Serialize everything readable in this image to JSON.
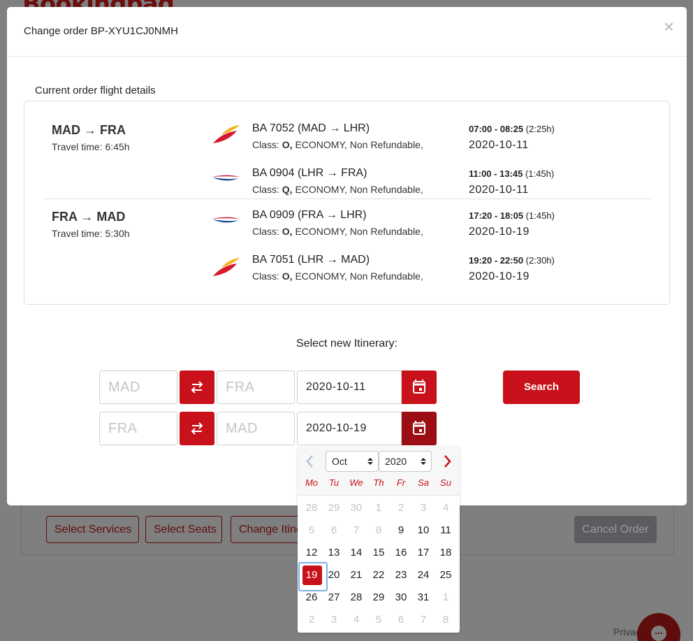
{
  "background": {
    "logo": "Bookingpad",
    "buttons": [
      "Select Services",
      "Select Seats",
      "Change Itine"
    ],
    "cancel_order": "Cancel Order",
    "privacy": "Privac",
    "chat_dots": "..."
  },
  "modal": {
    "title": "Change order BP-XYU1CJ0NMH",
    "close": "×",
    "section_title": "Current order flight details",
    "journeys": [
      {
        "route": "MAD → FRA",
        "travel_time": "Travel time: 6:45h",
        "flights": [
          {
            "airline_icon": "iberia-logo",
            "number": "BA 7052 (MAD → LHR)",
            "class_prefix": "Class: ",
            "class_code": "O,",
            "class_rest": " ECONOMY, Non Refundable,",
            "time_range": "07:00 - 08:25",
            "duration": " (2:25h)",
            "date": "2020-10-11"
          },
          {
            "airline_icon": "british-airways-logo",
            "number": "BA 0904 (LHR → FRA)",
            "class_prefix": "Class: ",
            "class_code": "Q,",
            "class_rest": " ECONOMY, Non Refundable,",
            "time_range": "11:00 - 13:45",
            "duration": " (1:45h)",
            "date": "2020-10-11"
          }
        ]
      },
      {
        "route": "FRA → MAD",
        "travel_time": "Travel time: 5:30h",
        "flights": [
          {
            "airline_icon": "british-airways-logo",
            "number": "BA 0909 (FRA → LHR)",
            "class_prefix": "Class: ",
            "class_code": "O,",
            "class_rest": " ECONOMY, Non Refundable,",
            "time_range": "17:20 - 18:05",
            "duration": " (1:45h)",
            "date": "2020-10-19"
          },
          {
            "airline_icon": "iberia-logo",
            "number": "BA 7051 (LHR → MAD)",
            "class_prefix": "Class: ",
            "class_code": "O,",
            "class_rest": " ECONOMY, Non Refundable,",
            "time_range": "19:20 - 22:50",
            "duration": " (2:30h)",
            "date": "2020-10-19"
          }
        ]
      }
    ],
    "itinerary_title": "Select new Itinerary:",
    "legs": [
      {
        "from_placeholder": "MAD",
        "to_placeholder": "FRA",
        "date": "2020-10-11"
      },
      {
        "from_placeholder": "FRA",
        "to_placeholder": "MAD",
        "date": "2020-10-19"
      }
    ],
    "search_label": "Search"
  },
  "datepicker": {
    "month": "Oct",
    "year": "2020",
    "weekdays": [
      "Mo",
      "Tu",
      "We",
      "Th",
      "Fr",
      "Sa",
      "Su"
    ],
    "days": [
      [
        "28",
        "29",
        "30",
        "1",
        "2",
        "3",
        "4"
      ],
      [
        "5",
        "6",
        "7",
        "8",
        "9",
        "10",
        "11"
      ],
      [
        "12",
        "13",
        "14",
        "15",
        "16",
        "17",
        "18"
      ],
      [
        "19",
        "20",
        "21",
        "22",
        "23",
        "24",
        "25"
      ],
      [
        "26",
        "27",
        "28",
        "29",
        "30",
        "31",
        "1"
      ],
      [
        "2",
        "3",
        "4",
        "5",
        "6",
        "7",
        "8"
      ]
    ],
    "muted": [
      [
        1,
        1,
        1,
        1,
        1,
        1,
        1
      ],
      [
        1,
        1,
        1,
        1,
        0,
        0,
        0
      ],
      [
        0,
        0,
        0,
        0,
        0,
        0,
        0
      ],
      [
        0,
        0,
        0,
        0,
        0,
        0,
        0
      ],
      [
        0,
        0,
        0,
        0,
        0,
        0,
        1
      ],
      [
        1,
        1,
        1,
        1,
        1,
        1,
        1
      ]
    ],
    "selected_day": "19",
    "colors": {
      "accent": "#c8111a",
      "accent_dark": "#9a0e14",
      "focus": "#7fb0e8"
    }
  }
}
